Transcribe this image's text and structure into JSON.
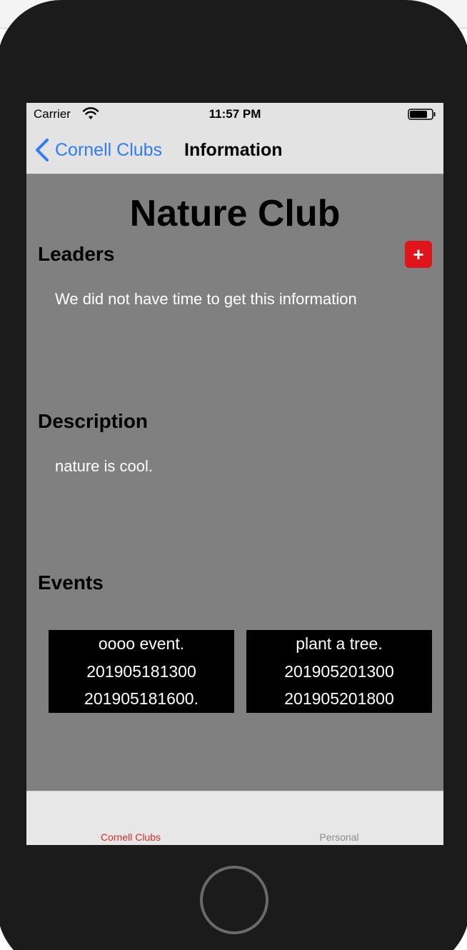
{
  "status_bar": {
    "carrier": "Carrier",
    "time": "11:57 PM"
  },
  "nav_bar": {
    "back_label": "Cornell Clubs",
    "title": "Information"
  },
  "club": {
    "name": "Nature Club"
  },
  "sections": {
    "leaders": {
      "heading": "Leaders",
      "text": "We did not have time to get this information",
      "add_label": "+"
    },
    "description": {
      "heading": "Description",
      "text": "nature is cool."
    },
    "events": {
      "heading": "Events",
      "items": [
        {
          "title": "oooo event.",
          "start": "201905181300",
          "end": "201905181600."
        },
        {
          "title": "plant a tree.",
          "start": "201905201300",
          "end": "201905201800"
        }
      ]
    }
  },
  "tab_bar": {
    "tabs": [
      {
        "label": "Cornell Clubs",
        "active": true
      },
      {
        "label": "Personal",
        "active": false
      }
    ]
  },
  "colors": {
    "accent_blue": "#2f7cf6",
    "add_button_red": "#e0151c",
    "tab_active_red": "#d52c2c",
    "content_background": "#808080"
  },
  "icons": [
    "wifi-icon",
    "battery-icon",
    "back-chevron-icon",
    "plus-icon"
  ]
}
